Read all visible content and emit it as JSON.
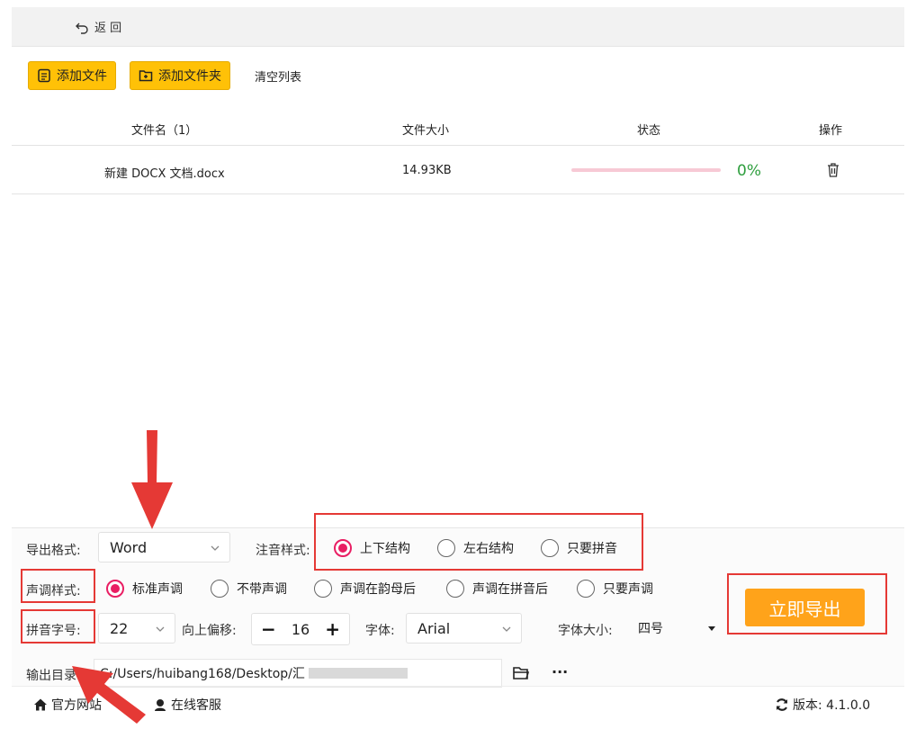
{
  "nav": {
    "back_label": "返 回"
  },
  "toolbar": {
    "add_file": "添加文件",
    "add_folder": "添加文件夹",
    "clear_list": "清空列表"
  },
  "table": {
    "headers": [
      "文件名（1）",
      "文件大小",
      "状态",
      "操作"
    ],
    "rows": [
      {
        "name": "新建 DOCX 文档.docx",
        "size": "14.93KB",
        "status": "0%",
        "progress": 0
      }
    ]
  },
  "settings": {
    "export_format": {
      "label": "导出格式:",
      "value": "Word"
    },
    "annotation_style": {
      "label": "注音样式:",
      "options": [
        "上下结构",
        "左右结构",
        "只要拼音"
      ],
      "selected": 0
    },
    "tone_style": {
      "label": "声调样式:",
      "options": [
        "标准声调",
        "不带声调",
        "声调在韵母后",
        "声调在拼音后",
        "只要声调"
      ],
      "selected": 0
    },
    "pinyin_size": {
      "label": "拼音字号:",
      "value": "22"
    },
    "offset": {
      "label": "向上偏移:",
      "minus": "−",
      "value": "16",
      "plus": "+"
    },
    "font": {
      "label": "字体:",
      "value": "Arial"
    },
    "font_size": {
      "label": "字体大小:",
      "value": "四号"
    },
    "output_dir": {
      "label": "输出目录:",
      "value": "C:/Users/huibang168/Desktop/汇",
      "more": "···"
    }
  },
  "export_button": "立即导出",
  "footer": {
    "official_site": "官方网站",
    "online_service": "在线客服",
    "version": "版本: 4.1.0.0"
  },
  "colors": {
    "accent": "#e91e63",
    "export": "#ffa31a",
    "yellow": "#ffc107",
    "highlight": "#e53935"
  }
}
